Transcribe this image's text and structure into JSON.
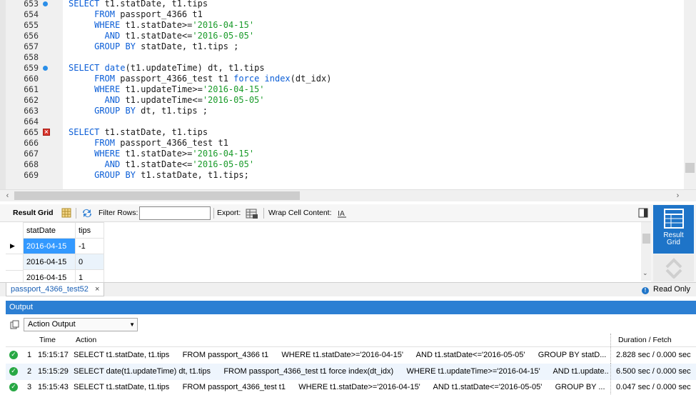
{
  "editor": {
    "lines": [
      {
        "num": "653",
        "marker": "dot",
        "indent": 0,
        "parts": [
          [
            "kw",
            "SELECT"
          ],
          [
            "t",
            " t1.statDate, t1.tips"
          ]
        ]
      },
      {
        "num": "654",
        "marker": "",
        "indent": 5,
        "parts": [
          [
            "kw",
            "FROM"
          ],
          [
            "t",
            " passport_4366 t1"
          ]
        ]
      },
      {
        "num": "655",
        "marker": "",
        "indent": 5,
        "parts": [
          [
            "kw",
            "WHERE"
          ],
          [
            "t",
            " t1.statDate>="
          ],
          [
            "str",
            "'2016-04-15'"
          ]
        ]
      },
      {
        "num": "656",
        "marker": "",
        "indent": 7,
        "parts": [
          [
            "kw",
            "AND"
          ],
          [
            "t",
            " t1.statDate<="
          ],
          [
            "str",
            "'2016-05-05'"
          ]
        ]
      },
      {
        "num": "657",
        "marker": "",
        "indent": 5,
        "parts": [
          [
            "kw",
            "GROUP BY"
          ],
          [
            "t",
            " statDate, t1.tips ;"
          ]
        ]
      },
      {
        "num": "658",
        "marker": "",
        "indent": 0,
        "parts": []
      },
      {
        "num": "659",
        "marker": "dot",
        "indent": 0,
        "parts": [
          [
            "kw",
            "SELECT"
          ],
          [
            "t",
            " "
          ],
          [
            "fn",
            "date"
          ],
          [
            "t",
            "(t1.updateTime) dt, t1.tips"
          ]
        ]
      },
      {
        "num": "660",
        "marker": "",
        "indent": 5,
        "parts": [
          [
            "kw",
            "FROM"
          ],
          [
            "t",
            " passport_4366_test t1 "
          ],
          [
            "kw",
            "force index"
          ],
          [
            "t",
            "(dt_idx)"
          ]
        ]
      },
      {
        "num": "661",
        "marker": "",
        "indent": 5,
        "parts": [
          [
            "kw",
            "WHERE"
          ],
          [
            "t",
            " t1.updateTime>="
          ],
          [
            "str",
            "'2016-04-15'"
          ]
        ]
      },
      {
        "num": "662",
        "marker": "",
        "indent": 7,
        "parts": [
          [
            "kw",
            "AND"
          ],
          [
            "t",
            " t1.updateTime<="
          ],
          [
            "str",
            "'2016-05-05'"
          ]
        ]
      },
      {
        "num": "663",
        "marker": "",
        "indent": 5,
        "parts": [
          [
            "kw",
            "GROUP BY"
          ],
          [
            "t",
            " dt, t1.tips ;"
          ]
        ]
      },
      {
        "num": "664",
        "marker": "",
        "indent": 0,
        "parts": []
      },
      {
        "num": "665",
        "marker": "err",
        "indent": 0,
        "parts": [
          [
            "kw",
            "SELECT"
          ],
          [
            "t",
            " t1.statDate, t1.tips"
          ]
        ]
      },
      {
        "num": "666",
        "marker": "",
        "indent": 5,
        "parts": [
          [
            "kw",
            "FROM"
          ],
          [
            "t",
            " passport_4366_test t1"
          ]
        ]
      },
      {
        "num": "667",
        "marker": "",
        "indent": 5,
        "parts": [
          [
            "kw",
            "WHERE"
          ],
          [
            "t",
            " t1.statDate>="
          ],
          [
            "str",
            "'2016-04-15'"
          ]
        ]
      },
      {
        "num": "668",
        "marker": "",
        "indent": 7,
        "parts": [
          [
            "kw",
            "AND"
          ],
          [
            "t",
            " t1.statDate<="
          ],
          [
            "str",
            "'2016-05-05'"
          ]
        ]
      },
      {
        "num": "669",
        "marker": "",
        "indent": 5,
        "parts": [
          [
            "kw",
            "GROUP BY"
          ],
          [
            "t",
            " t1.statDate, t1.tips;"
          ]
        ]
      }
    ]
  },
  "result_toolbar": {
    "result_grid_label": "Result Grid",
    "filter_rows_label": "Filter Rows:",
    "filter_value": "",
    "export_label": "Export:",
    "wrap_label": "Wrap Cell Content:"
  },
  "grid": {
    "columns": [
      "statDate",
      "tips"
    ],
    "rows": [
      [
        "2016-04-15",
        "-1"
      ],
      [
        "2016-04-15",
        "0"
      ],
      [
        "2016-04-15",
        "1"
      ]
    ]
  },
  "side_panel": {
    "result_grid_btn": "Result\nGrid"
  },
  "tabs": {
    "active_tab": "passport_4366_test52",
    "close": "×",
    "read_only": "Read Only"
  },
  "output": {
    "title": "Output",
    "dropdown_value": "Action Output",
    "headers": {
      "time": "Time",
      "action": "Action",
      "duration": "Duration / Fetch"
    },
    "rows": [
      {
        "num": "1",
        "time": "15:15:17",
        "action": "SELECT t1.statDate, t1.tips      FROM passport_4366 t1      WHERE t1.statDate>='2016-04-15'      AND t1.statDate<='2016-05-05'      GROUP BY statD...",
        "duration": "2.828 sec / 0.000 sec"
      },
      {
        "num": "2",
        "time": "15:15:29",
        "action": "SELECT date(t1.updateTime) dt, t1.tips      FROM passport_4366_test t1 force index(dt_idx)      WHERE t1.updateTime>='2016-04-15'      AND t1.update...",
        "duration": "6.500 sec / 0.000 sec"
      },
      {
        "num": "3",
        "time": "15:15:43",
        "action": "SELECT t1.statDate, t1.tips      FROM passport_4366_test t1      WHERE t1.statDate>='2016-04-15'      AND t1.statDate<='2016-05-05'      GROUP BY ...",
        "duration": "0.047 sec / 0.000 sec"
      }
    ]
  },
  "colors": {
    "keyword": "#0b5ed7",
    "string": "#1a9b2a",
    "accent": "#2c7fd3",
    "success": "#27a844",
    "error": "#d9342b"
  }
}
